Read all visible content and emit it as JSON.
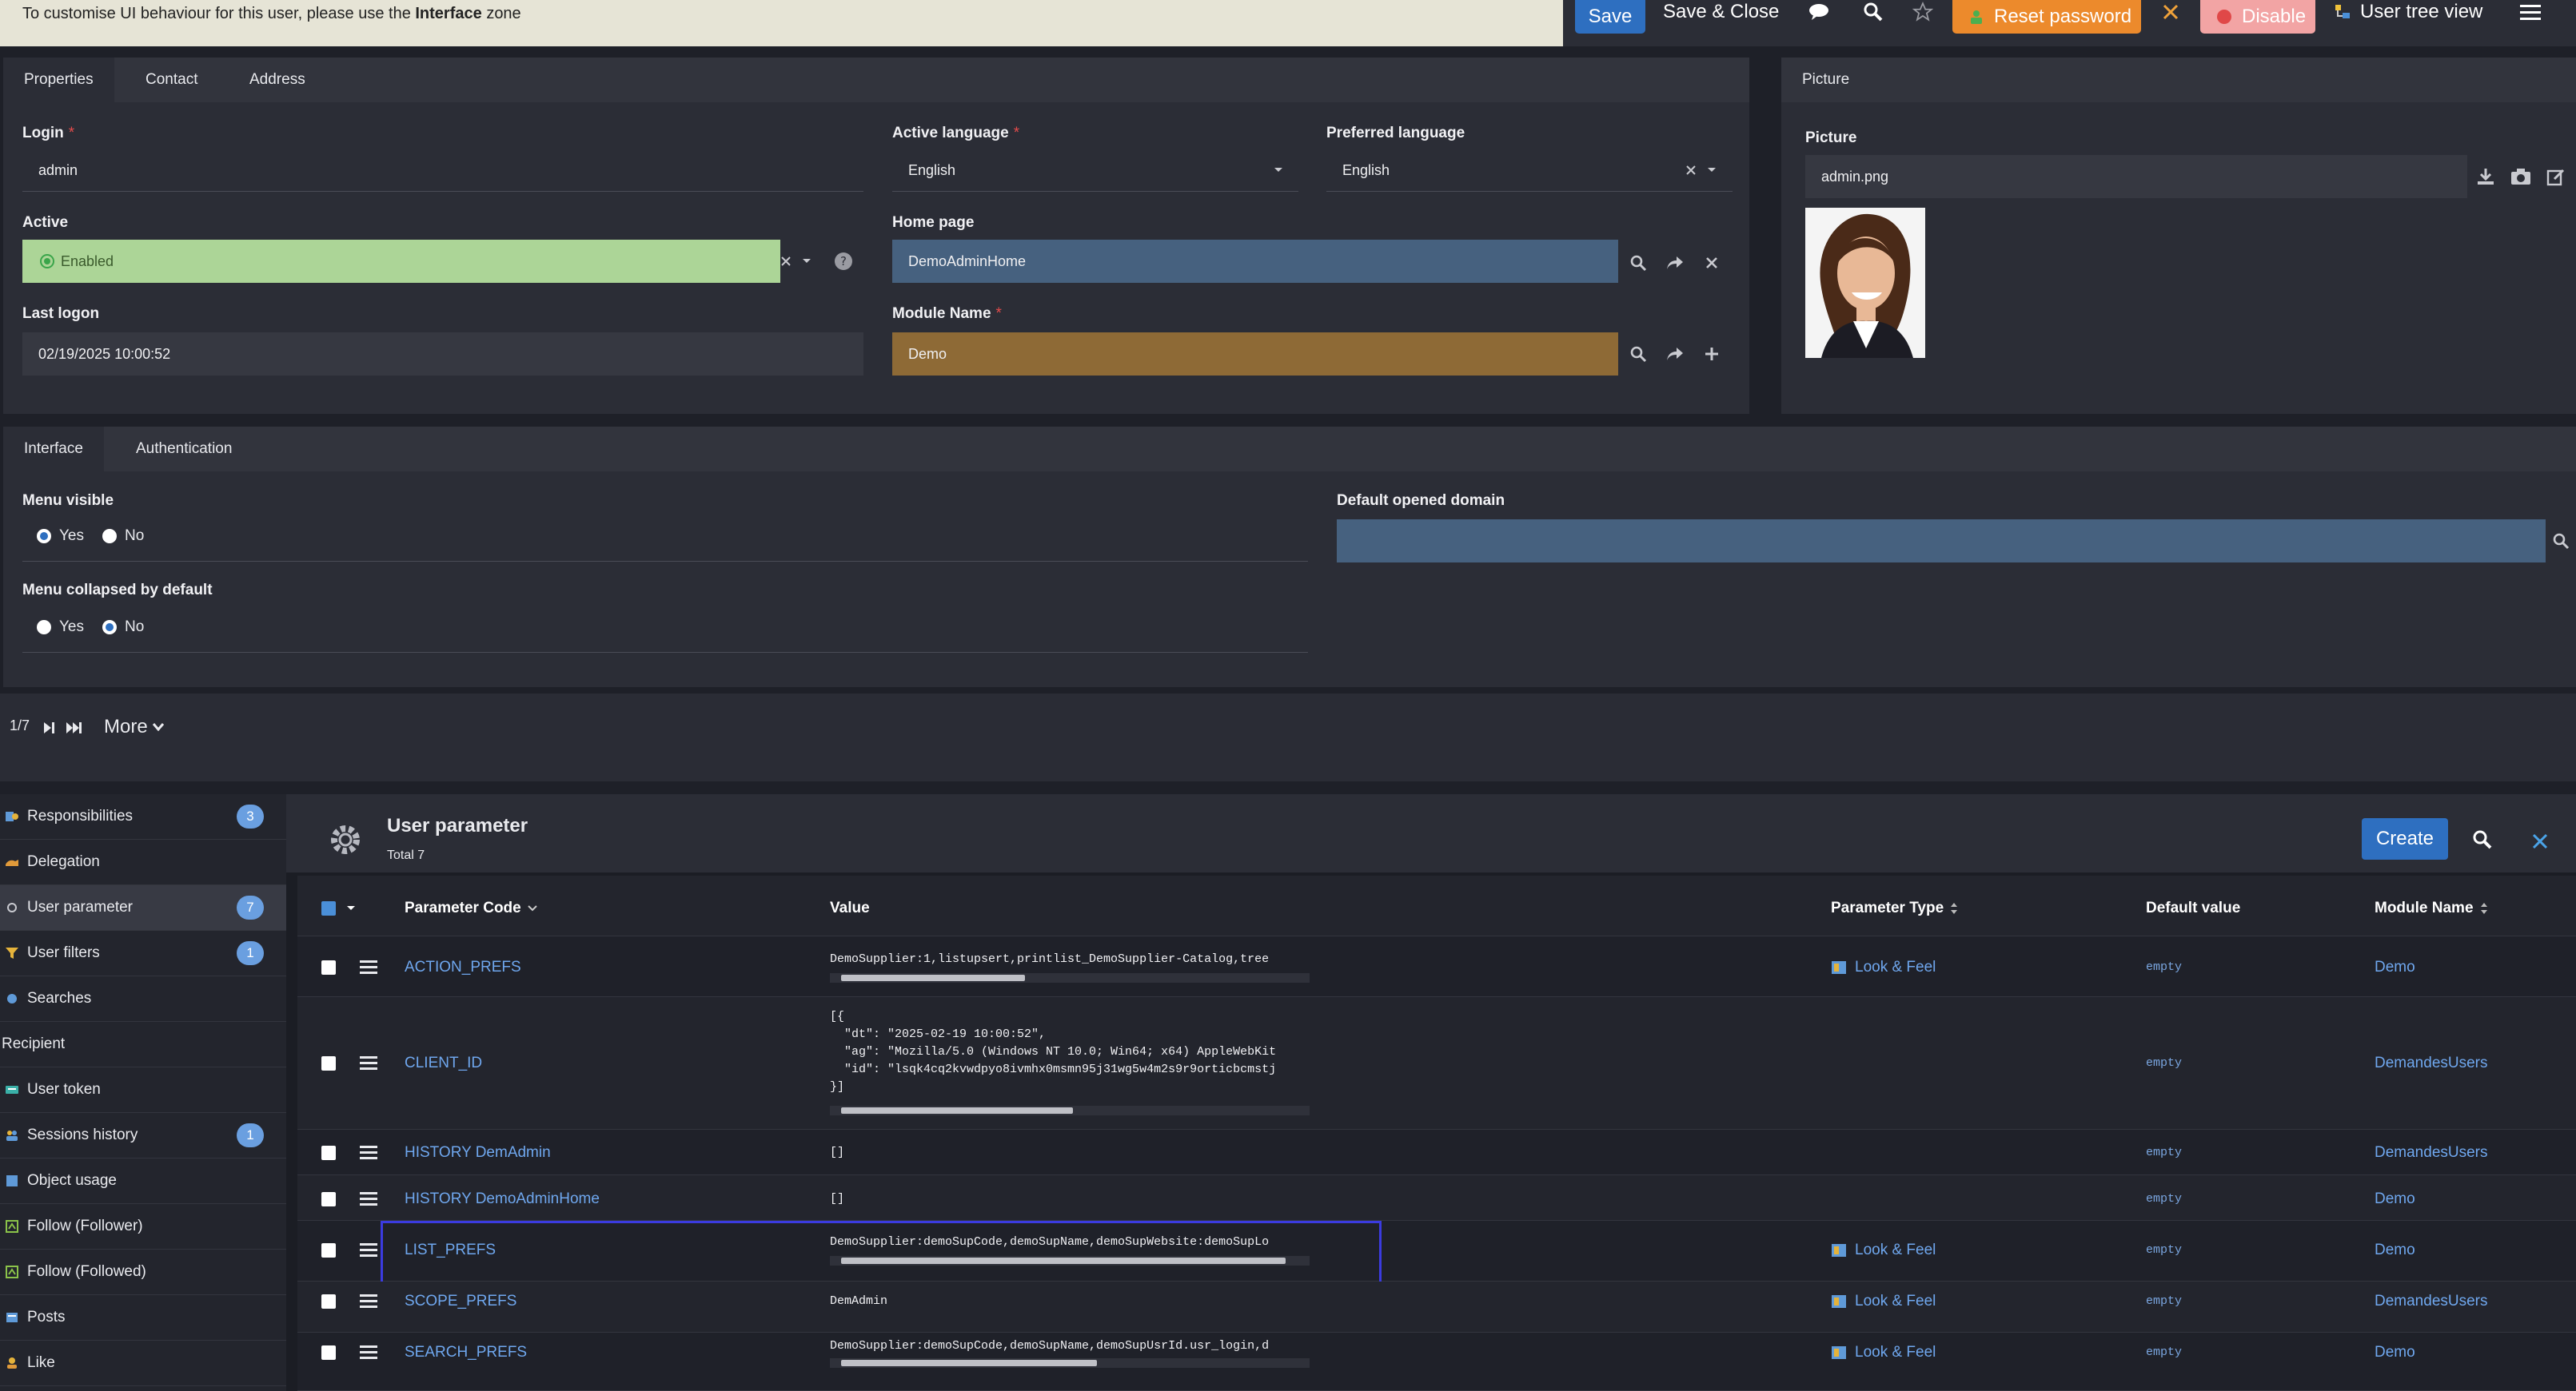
{
  "notice": {
    "prefix": "To customise UI behaviour for this user, please use the",
    "bold": "Interface",
    "suffix": "zone"
  },
  "toolbar": {
    "save": "Save",
    "save_close": "Save & Close",
    "reset_password": "Reset password",
    "disable": "Disable",
    "user_tree_view": "User tree view"
  },
  "colors": {
    "accent": "#2e6fc0",
    "enabled_field": "#acd597",
    "home_page_field": "#46617f",
    "module_field": "#8e6a36",
    "reset_btn": "#ec8a2c",
    "disable_btn": "#f2a4a4",
    "link": "#6fa7ee",
    "highlight": "#3b3be0"
  },
  "form": {
    "tabs": [
      "Properties",
      "Contact",
      "Address"
    ],
    "login": {
      "label": "Login",
      "value": "admin"
    },
    "active_language": {
      "label": "Active language",
      "value": "English"
    },
    "preferred_language": {
      "label": "Preferred language",
      "value": "English"
    },
    "active": {
      "label": "Active",
      "value": "Enabled"
    },
    "home_page": {
      "label": "Home page",
      "value": "DemoAdminHome"
    },
    "last_logon": {
      "label": "Last logon",
      "value": "02/19/2025 10:00:52"
    },
    "module_name": {
      "label": "Module Name",
      "value": "Demo"
    }
  },
  "picture": {
    "tab": "Picture",
    "label": "Picture",
    "value": "admin.png"
  },
  "interface": {
    "tabs": [
      "Interface",
      "Authentication"
    ],
    "menu_visible": {
      "label": "Menu visible",
      "yes": "Yes",
      "no": "No",
      "selected": "Yes"
    },
    "menu_collapsed": {
      "label": "Menu collapsed by default",
      "yes": "Yes",
      "no": "No",
      "selected": "No"
    },
    "default_domain": {
      "label": "Default opened domain",
      "value": ""
    }
  },
  "pager": {
    "position": "1/7",
    "more": "More"
  },
  "sidebar": {
    "items": [
      {
        "label": "Responsibilities",
        "badge": "3",
        "icon": "responsibilities-icon"
      },
      {
        "label": "Delegation",
        "badge": "",
        "icon": "delegation-icon"
      },
      {
        "label": "User parameter",
        "badge": "7",
        "icon": "gear-icon"
      },
      {
        "label": "User filters",
        "badge": "1",
        "icon": "filter-icon"
      },
      {
        "label": "Searches",
        "badge": "",
        "icon": "search-dot-icon"
      }
    ],
    "section": "Recipient",
    "items2": [
      {
        "label": "User token",
        "badge": "",
        "icon": "token-icon"
      },
      {
        "label": "Sessions history",
        "badge": "1",
        "icon": "users-icon"
      },
      {
        "label": "Object usage",
        "badge": "",
        "icon": "object-icon"
      },
      {
        "label": "Follow (Follower)",
        "badge": "",
        "icon": "follow-icon"
      },
      {
        "label": "Follow (Followed)",
        "badge": "",
        "icon": "follow-icon"
      },
      {
        "label": "Posts",
        "badge": "",
        "icon": "posts-icon"
      },
      {
        "label": "Like",
        "badge": "",
        "icon": "like-icon"
      }
    ]
  },
  "list": {
    "title": "User parameter",
    "total": "Total 7",
    "create": "Create",
    "columns": [
      "Parameter Code",
      "Value",
      "Parameter Type",
      "Default value",
      "Module Name"
    ],
    "rows": [
      {
        "code": "ACTION_PREFS",
        "value": "DemoSupplier:1,listupsert,printlist_DemoSupplier-Catalog,tree",
        "type": "Look & Feel",
        "default": "empty",
        "module": "Demo"
      },
      {
        "code": "CLIENT_ID",
        "value": "[{\n  \"dt\": \"2025-02-19 10:00:52\",\n  \"ag\": \"Mozilla/5.0 (Windows NT 10.0; Win64; x64) AppleWebKit\n  \"id\": \"lsqk4cq2kvwdpyo8ivmhx0msmn95j31wg5w4m2s9r9orticbcmstj\n}]",
        "type": "",
        "default": "empty",
        "module": "DemandesUsers"
      },
      {
        "code": "HISTORY DemAdmin",
        "value": "[]",
        "type": "",
        "default": "empty",
        "module": "DemandesUsers"
      },
      {
        "code": "HISTORY DemoAdminHome",
        "value": "[]",
        "type": "",
        "default": "empty",
        "module": "Demo"
      },
      {
        "code": "LIST_PREFS",
        "value": "DemoSupplier:demoSupCode,demoSupName,demoSupWebsite:demoSupLo",
        "type": "Look & Feel",
        "default": "empty",
        "module": "Demo"
      },
      {
        "code": "SCOPE_PREFS",
        "value": "DemAdmin",
        "type": "Look & Feel",
        "default": "empty",
        "module": "DemandesUsers"
      },
      {
        "code": "SEARCH_PREFS",
        "value": "DemoSupplier:demoSupCode,demoSupName,demoSupUsrId.usr_login,d",
        "type": "Look & Feel",
        "default": "empty",
        "module": "Demo"
      }
    ]
  }
}
